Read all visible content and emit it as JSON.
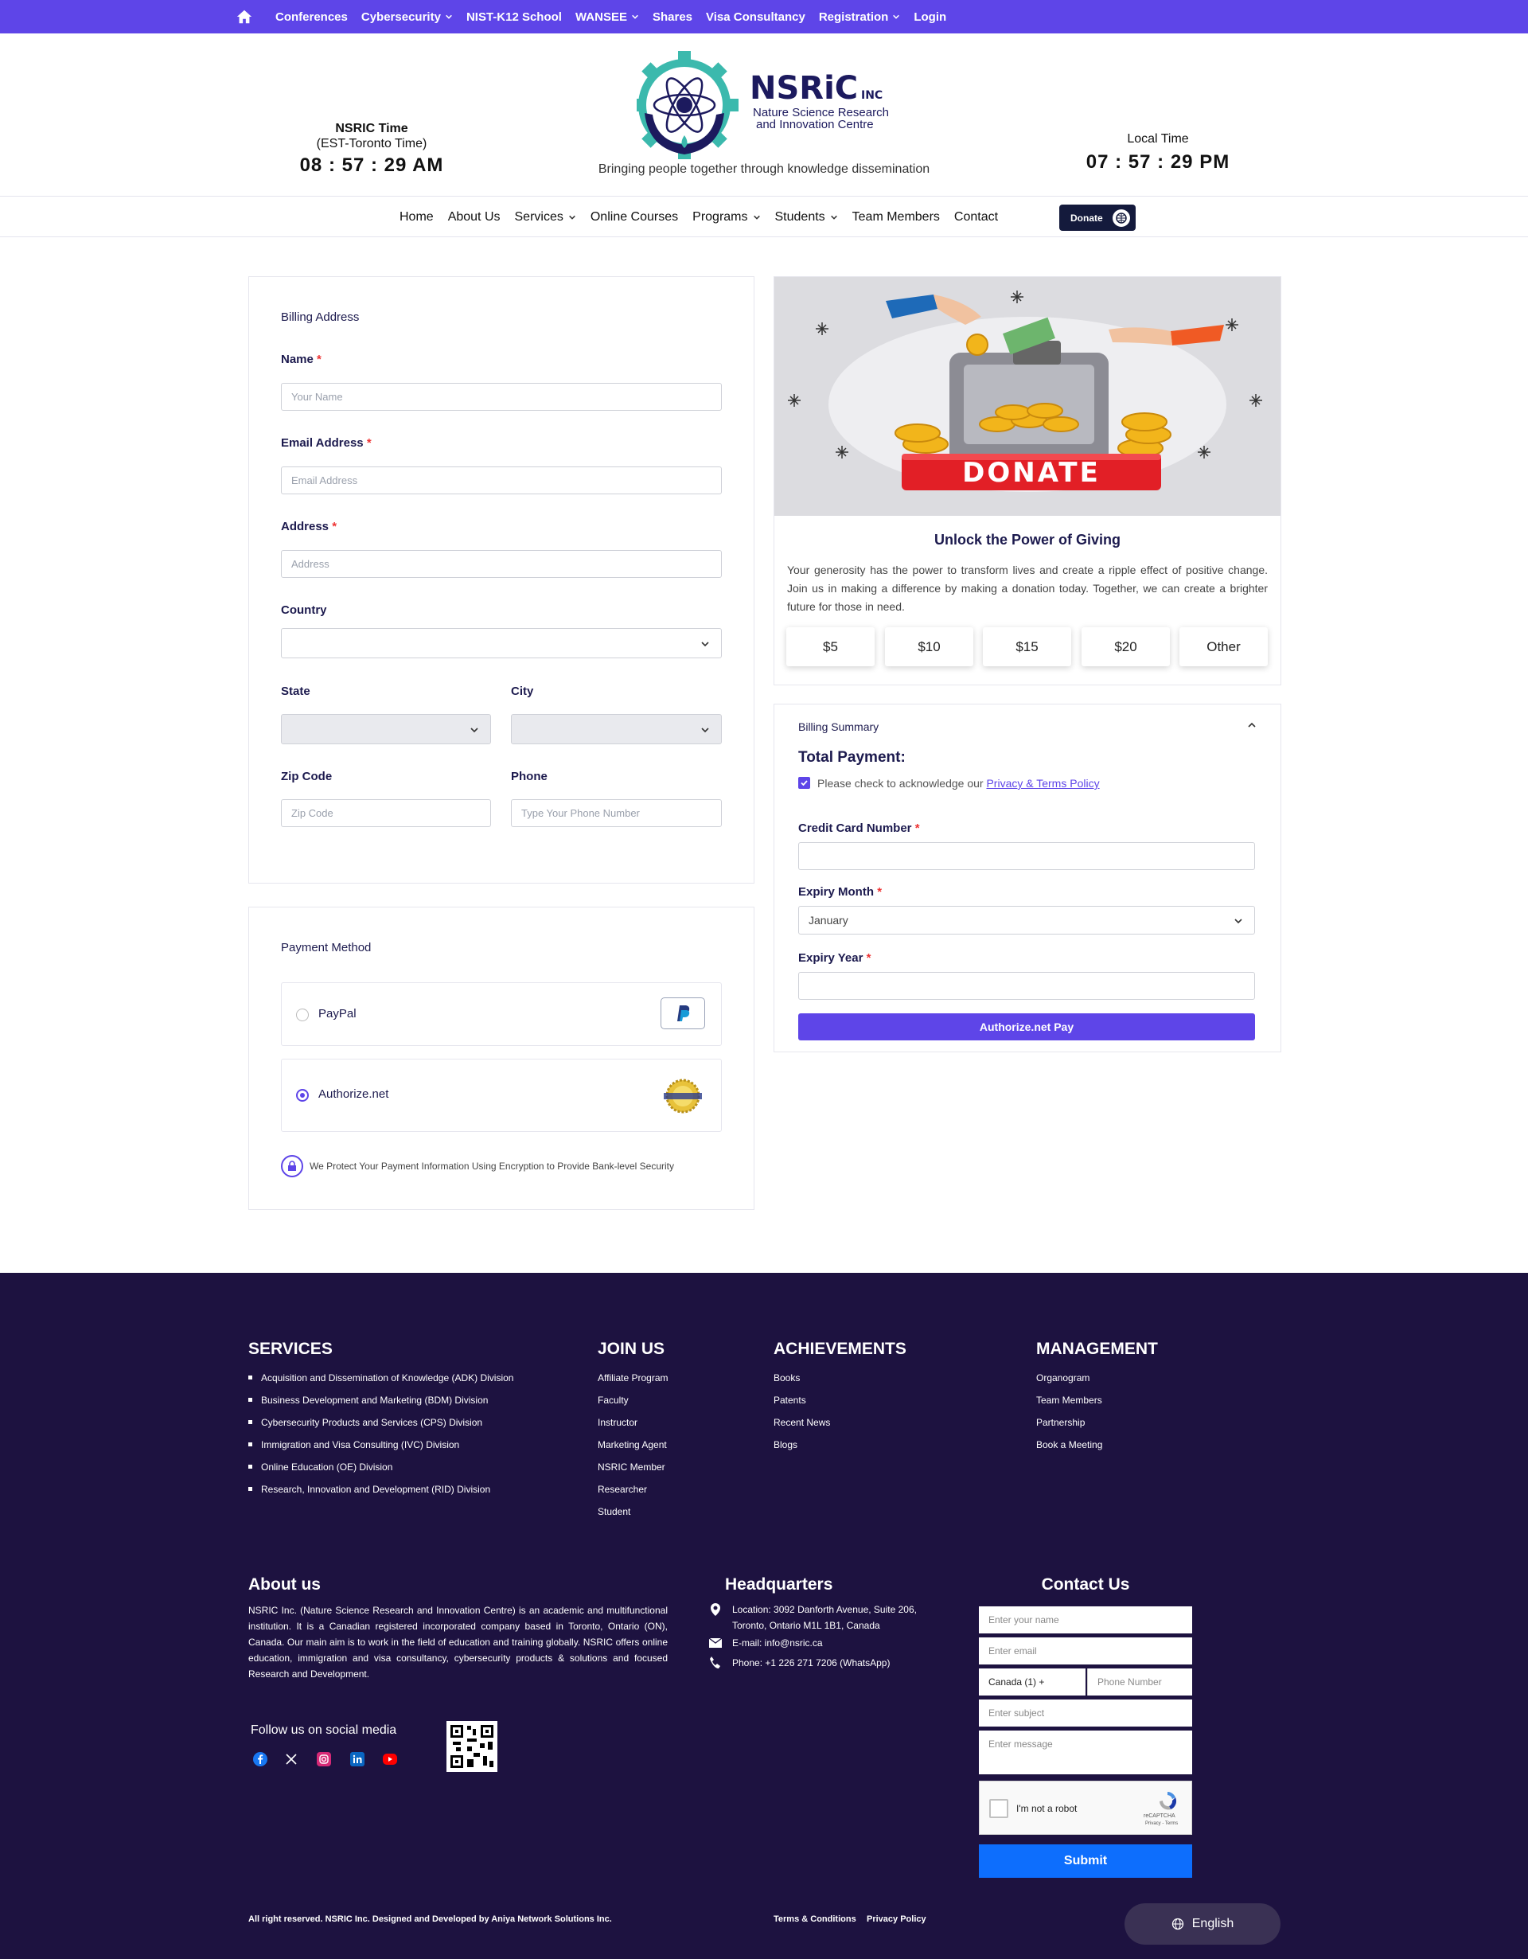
{
  "topbar": {
    "items": [
      {
        "label": "Conferences",
        "dropdown": false
      },
      {
        "label": "Cybersecurity",
        "dropdown": true
      },
      {
        "label": "NIST-K12 School",
        "dropdown": false
      },
      {
        "label": "WANSEE",
        "dropdown": true
      },
      {
        "label": "Shares",
        "dropdown": false
      },
      {
        "label": "Visa Consultancy",
        "dropdown": false
      },
      {
        "label": "Registration",
        "dropdown": true
      },
      {
        "label": "Login",
        "dropdown": false
      }
    ],
    "bg_color": "#5e45e8"
  },
  "header": {
    "nsric_time_label": "NSRIC Time",
    "nsric_time_zone": "(EST-Toronto Time)",
    "nsric_time": "08 : 57 : 29 AM",
    "local_time_label": "Local Time",
    "local_time": "07 : 57 : 29 PM",
    "logo_text": "NSRiC",
    "logo_inc": "INC",
    "logo_sub1": "Nature Science Research",
    "logo_sub2": "and Innovation Centre",
    "tagline": "Bringing people together through knowledge dissemination"
  },
  "mainnav": {
    "items": [
      {
        "label": "Home",
        "dropdown": false
      },
      {
        "label": "About Us",
        "dropdown": false
      },
      {
        "label": "Services",
        "dropdown": true
      },
      {
        "label": "Online Courses",
        "dropdown": false
      },
      {
        "label": "Programs",
        "dropdown": true
      },
      {
        "label": "Students",
        "dropdown": true
      },
      {
        "label": "Team Members",
        "dropdown": false
      },
      {
        "label": "Contact",
        "dropdown": false
      }
    ],
    "donate_label": "Donate"
  },
  "billing": {
    "title": "Billing Address",
    "name_label": "Name",
    "name_placeholder": "Your Name",
    "email_label": "Email Address",
    "email_placeholder": "Email Address",
    "address_label": "Address",
    "address_placeholder": "Address",
    "country_label": "Country",
    "country_value": "",
    "state_label": "State",
    "city_label": "City",
    "zip_label": "Zip Code",
    "zip_placeholder": "Zip Code",
    "phone_label": "Phone",
    "phone_placeholder": "Type Your Phone Number",
    "required_mark": "*"
  },
  "payment": {
    "title": "Payment Method",
    "options": [
      {
        "label": "PayPal",
        "selected": false
      },
      {
        "label": "Authorize.net",
        "selected": true
      }
    ],
    "security_note": "We Protect Your Payment Information Using Encryption to Provide Bank-level Security"
  },
  "donate": {
    "banner_text": "DONATE",
    "title": "Unlock the Power of Giving",
    "text": "Your generosity has the power to transform lives and create a ripple effect of positive change. Join us in making a difference by making a donation today. Together, we can create a brighter future for those in need.",
    "amounts": [
      "$5",
      "$10",
      "$15",
      "$20",
      "Other"
    ]
  },
  "summary": {
    "title": "Billing Summary",
    "total_label": "Total Payment:",
    "ack_text": "Please check to acknowledge our",
    "ack_link": "Privacy & Terms Policy",
    "ack_checked": true,
    "cc_label": "Credit Card Number",
    "month_label": "Expiry Month",
    "month_value": "January",
    "year_label": "Expiry Year",
    "pay_button": "Authorize.net Pay"
  },
  "footer": {
    "services": {
      "title": "SERVICES",
      "items": [
        "Acquisition and Dissemination of Knowledge (ADK) Division",
        "Business Development and Marketing (BDM) Division",
        "Cybersecurity Products and Services (CPS) Division",
        "Immigration and Visa Consulting (IVC) Division",
        "Online Education (OE) Division",
        "Research, Innovation and Development (RID) Division"
      ]
    },
    "join": {
      "title": "JOIN US",
      "items": [
        "Affiliate Program",
        "Faculty",
        "Instructor",
        "Marketing Agent",
        "NSRIC Member",
        "Researcher",
        "Student"
      ]
    },
    "achievements": {
      "title": "ACHIEVEMENTS",
      "items": [
        "Books",
        "Patents",
        "Recent News",
        "Blogs"
      ]
    },
    "management": {
      "title": "MANAGEMENT",
      "items": [
        "Organogram",
        "Team Members",
        "Partnership",
        "Book a Meeting"
      ]
    },
    "about": {
      "title": "About us",
      "text": "NSRIC Inc. (Nature Science Research and Innovation Centre) is an academic and multifunctional institution. It is a Canadian registered incorporated company based in Toronto, Ontario (ON), Canada. Our main aim is to work in the field of education and training globally. NSRIC offers online education, immigration and visa consultancy, cybersecurity products & solutions and focused Research and Development.",
      "follow": "Follow us on social media"
    },
    "hq": {
      "title": "Headquarters",
      "location": "Location: 3092 Danforth Avenue, Suite 206, Toronto, Ontario M1L 1B1, Canada",
      "email": "E-mail: info@nsric.ca",
      "phone": "Phone: +1 226 271 7206 (WhatsApp)"
    },
    "contact": {
      "title": "Contact Us",
      "name_placeholder": "Enter your name",
      "email_placeholder": "Enter email",
      "country_code": "Canada (1) +",
      "phone_placeholder": "Phone Number",
      "subject_placeholder": "Enter subject",
      "message_placeholder": "Enter message",
      "captcha_label": "I'm not a robot",
      "captcha_brand": "reCAPTCHA",
      "captcha_terms": "Privacy - Terms",
      "submit": "Submit"
    },
    "copyright": "All right reserved. NSRIC Inc. Designed and Developed by Aniya Network Solutions Inc.",
    "terms": "Terms & Conditions",
    "privacy": "Privacy Policy",
    "language": "English",
    "bg_color": "#1d1240"
  }
}
